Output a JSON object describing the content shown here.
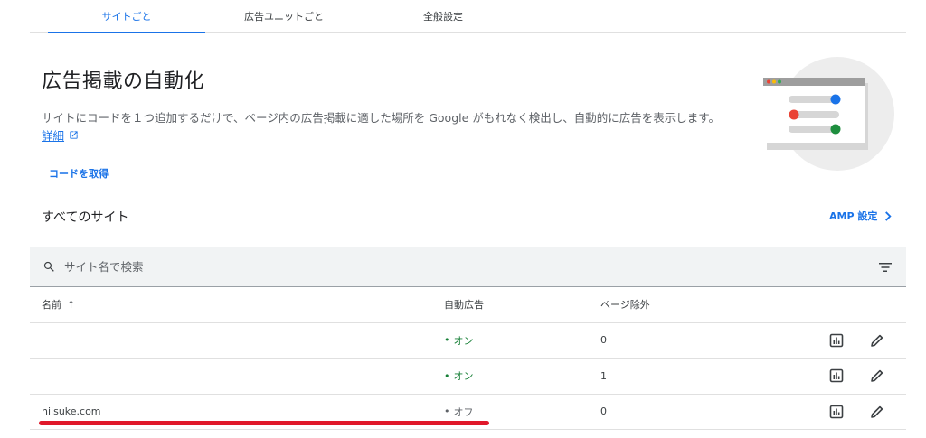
{
  "tabs": [
    {
      "label": "サイトごと",
      "active": true
    },
    {
      "label": "広告ユニットごと",
      "active": false
    },
    {
      "label": "全般設定",
      "active": false
    }
  ],
  "header": {
    "title": "広告掲載の自動化",
    "description": "サイトにコードを１つ追加するだけで、ページ内の広告掲載に適した場所を Google がもれなく検出し、自動的に広告を表示します。",
    "details_link": "詳細",
    "get_code": "コードを取得"
  },
  "sites_section": {
    "title": "すべてのサイト",
    "amp_settings": "AMP 設定"
  },
  "search": {
    "placeholder": "サイト名で検索"
  },
  "table": {
    "columns": {
      "name": "名前",
      "auto_ads": "自動広告",
      "page_exclusions": "ページ除外"
    },
    "rows": [
      {
        "name": "",
        "auto_ads": "オン",
        "auto_ads_on": true,
        "page_exclusions": "0"
      },
      {
        "name": "",
        "auto_ads": "オン",
        "auto_ads_on": true,
        "page_exclusions": "1"
      },
      {
        "name": "hiisuke.com",
        "auto_ads": "オフ",
        "auto_ads_on": false,
        "page_exclusions": "0"
      }
    ]
  },
  "colors": {
    "accent": "#1a73e8",
    "on_green": "#188038",
    "annotation_red": "#e0182a"
  },
  "icons": {
    "search": "search-icon",
    "filter": "filter-icon",
    "report": "bar-chart-icon",
    "edit": "pencil-icon",
    "external": "open-in-new-icon",
    "chevron": "chevron-right-icon"
  }
}
